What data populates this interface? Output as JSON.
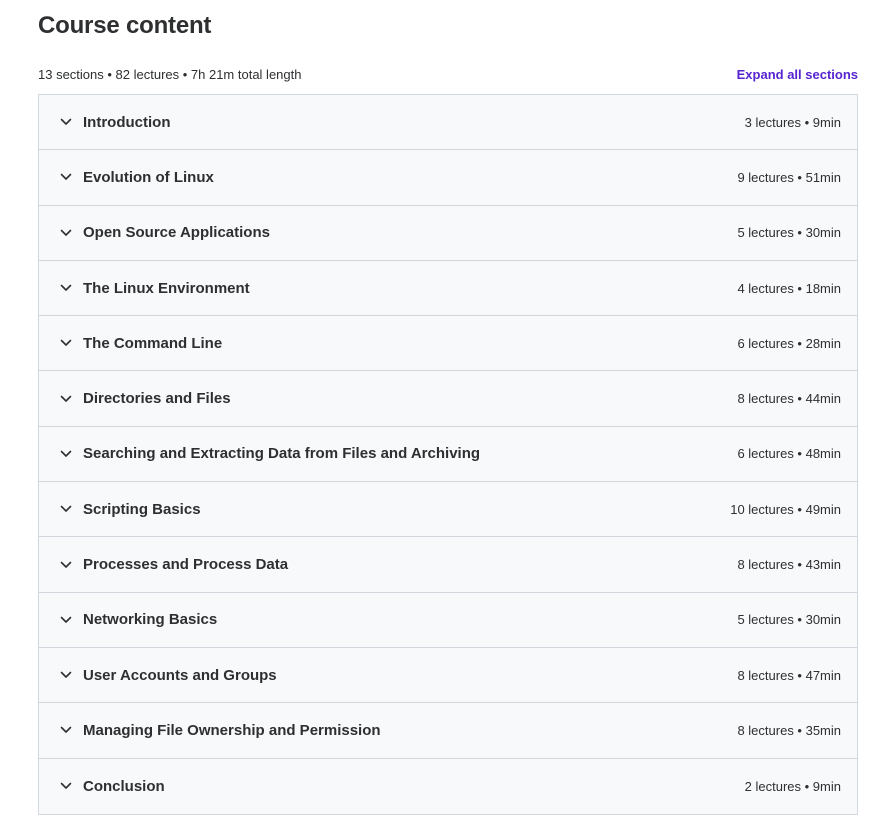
{
  "header": {
    "title": "Course content",
    "summary": "13 sections • 82 lectures • 7h 21m total length",
    "expand_all_label": "Expand all sections"
  },
  "colors": {
    "accent": "#5624d0",
    "text": "#2d2f31",
    "row_background": "#f7f9fa",
    "border": "#d1d7dc"
  },
  "sections": [
    {
      "title": "Introduction",
      "meta": "3 lectures • 9min",
      "icon": "chevron-down-icon"
    },
    {
      "title": "Evolution of Linux",
      "meta": "9 lectures • 51min",
      "icon": "chevron-down-icon"
    },
    {
      "title": "Open Source Applications",
      "meta": "5 lectures • 30min",
      "icon": "chevron-down-icon"
    },
    {
      "title": "The Linux Environment",
      "meta": "4 lectures • 18min",
      "icon": "chevron-down-icon"
    },
    {
      "title": "The Command Line",
      "meta": "6 lectures • 28min",
      "icon": "chevron-down-icon"
    },
    {
      "title": "Directories and Files",
      "meta": "8 lectures • 44min",
      "icon": "chevron-down-icon"
    },
    {
      "title": "Searching and Extracting Data from Files and Archiving",
      "meta": "6 lectures • 48min",
      "icon": "chevron-down-icon"
    },
    {
      "title": "Scripting Basics",
      "meta": "10 lectures • 49min",
      "icon": "chevron-down-icon"
    },
    {
      "title": "Processes and Process Data",
      "meta": "8 lectures • 43min",
      "icon": "chevron-down-icon"
    },
    {
      "title": "Networking Basics",
      "meta": "5 lectures • 30min",
      "icon": "chevron-down-icon"
    },
    {
      "title": "User Accounts and Groups",
      "meta": "8 lectures • 47min",
      "icon": "chevron-down-icon"
    },
    {
      "title": "Managing File Ownership and Permission",
      "meta": "8 lectures • 35min",
      "icon": "chevron-down-icon"
    },
    {
      "title": "Conclusion",
      "meta": "2 lectures • 9min",
      "icon": "chevron-down-icon"
    }
  ]
}
